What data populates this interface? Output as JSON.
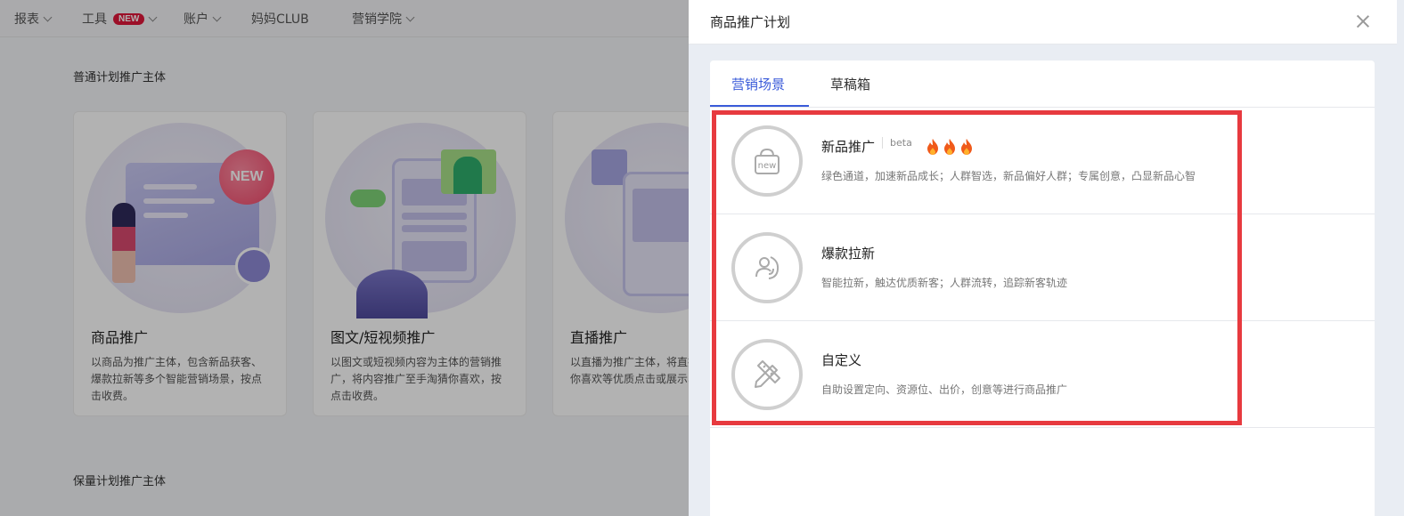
{
  "background": {
    "nav": [
      {
        "label": "报表",
        "chevron": true
      },
      {
        "label": "工具",
        "badge": "NEW",
        "chevron": true
      },
      {
        "label": "账户",
        "chevron": true
      },
      {
        "label": "妈妈CLUB",
        "chevron": false
      },
      {
        "label": "营销学院",
        "chevron": true
      }
    ],
    "section_normal": "普通计划推广主体",
    "section_reserved": "保量计划推广主体",
    "cards": [
      {
        "title": "商品推广",
        "desc": "以商品为推广主体，包含新品获客、爆款拉新等多个智能营销场景，按点击收费。",
        "bubble": "NEW"
      },
      {
        "title": "图文/短视频推广",
        "desc": "以图文或短视频内容为主体的营销推广，将内容推广至手淘猜你喜欢，按点击收费。"
      },
      {
        "title": "直播推广",
        "desc": "以直播为推广主体，将直播广场、猜你喜欢等优质点击或展示收费。"
      }
    ]
  },
  "drawer": {
    "title": "商品推广计划",
    "tabs": [
      {
        "label": "营销场景",
        "active": true
      },
      {
        "label": "草稿箱",
        "active": false
      }
    ],
    "scenes": [
      {
        "title": "新品推广",
        "tag": "beta",
        "hot": 3,
        "icon": "new-bag-icon",
        "icon_text": "new",
        "desc": "绿色通道，加速新品成长；人群智选，新品偏好人群；专属创意，凸显新品心智"
      },
      {
        "title": "爆款拉新",
        "icon": "user-growth-icon",
        "desc": "智能拉新，触达优质新客；人群流转，追踪新客轨迹"
      },
      {
        "title": "自定义",
        "icon": "pencil-ruler-icon",
        "desc": "自助设置定向、资源位、出价，创意等进行商品推广"
      }
    ]
  },
  "colors": {
    "accent": "#3a5bd9",
    "highlight": "#e73a3f",
    "badge": "#e0163a"
  }
}
